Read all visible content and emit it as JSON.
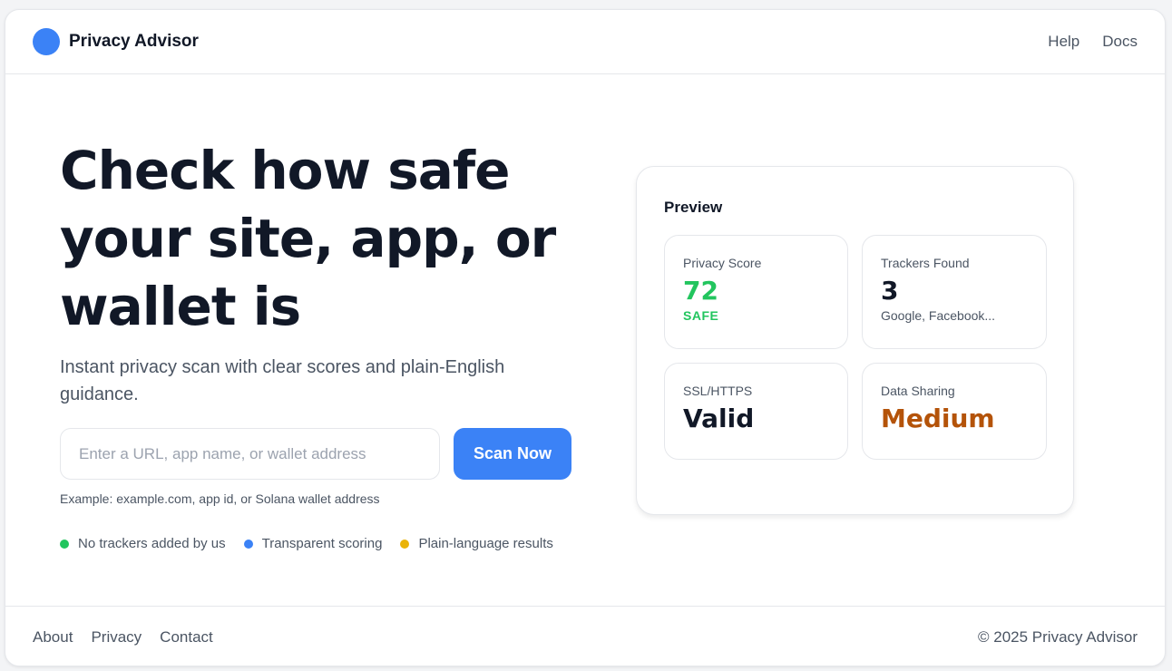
{
  "colors": {
    "accent": "#3b82f6",
    "safe": "#22c55e",
    "warning": "#b45309",
    "feature_dots": [
      "#22c55e",
      "#3b82f6",
      "#eab308"
    ]
  },
  "header": {
    "brand_name": "Privacy Advisor",
    "brand_icon": "blue-circle-logo",
    "nav": [
      "Help",
      "Docs"
    ]
  },
  "hero": {
    "title_lines": [
      "Check how safe",
      "your site, app, or",
      "wallet is"
    ],
    "subtitle": "Instant privacy scan with clear scores and plain-English guidance.",
    "search": {
      "placeholder": "Enter a URL, app name, or wallet address",
      "value": ""
    },
    "scan_button": "Scan Now",
    "example": "Example: example.com, app id, or Solana wallet address",
    "features": [
      "No trackers added by us",
      "Transparent scoring",
      "Plain-language results"
    ]
  },
  "preview": {
    "title": "Preview",
    "cards": [
      {
        "label": "Privacy Score",
        "value": "72",
        "sub": "SAFE"
      },
      {
        "label": "Trackers Found",
        "value": "3",
        "sub": "Google, Facebook..."
      },
      {
        "label": "SSL/HTTPS",
        "value": "Valid"
      },
      {
        "label": "Data Sharing",
        "value": "Medium"
      }
    ]
  },
  "footer": {
    "links": [
      "About",
      "Privacy",
      "Contact"
    ],
    "copyright": "© 2025 Privacy Advisor"
  }
}
